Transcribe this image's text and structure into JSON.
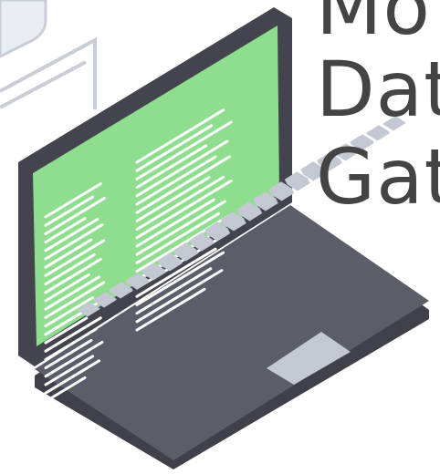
{
  "title": {
    "lines": [
      "Mo",
      "Dat",
      "Gat"
    ]
  },
  "colors": {
    "screen": "#8fdd8f",
    "code_lines": "#ffffff",
    "bezel": "#43444e",
    "base_top": "#5b5d69",
    "base_side": "#3f4049",
    "keys": "#c3c8d2",
    "title_text": "#444444",
    "device_outline": "#c8cdd6"
  },
  "icons": [
    "laptop-icon",
    "device-outline-icon"
  ]
}
